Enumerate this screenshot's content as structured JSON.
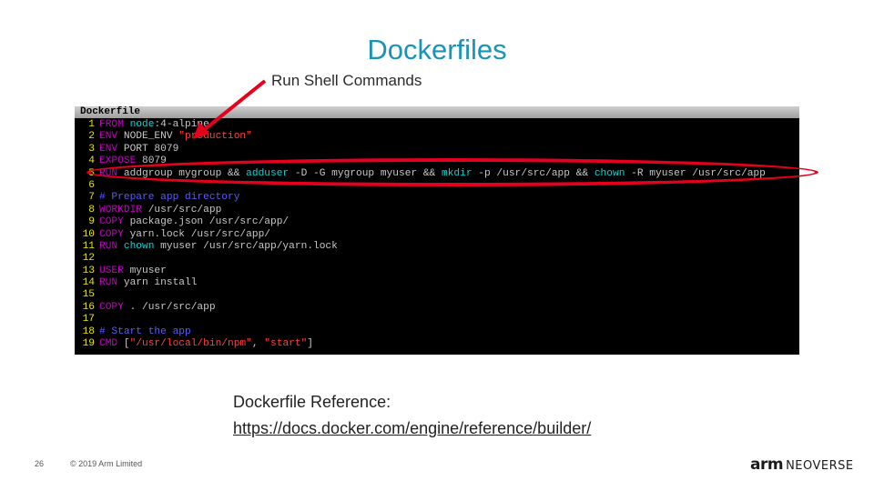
{
  "slide": {
    "title": "Dockerfiles",
    "callout": "Run Shell Commands",
    "reference_label": "Dockerfile Reference:",
    "reference_link": "https://docs.docker.com/engine/reference/builder/",
    "page_number": "26",
    "copyright": "© 2019 Arm Limited",
    "logo_primary": "arm",
    "logo_secondary": "NEOVERSE"
  },
  "editor": {
    "tab_label": "Dockerfile",
    "lines": [
      {
        "n": "1",
        "segments": [
          [
            "kw",
            "FROM "
          ],
          [
            "cmd",
            "node"
          ],
          [
            "plain",
            ":4-alpine"
          ]
        ]
      },
      {
        "n": "2",
        "segments": [
          [
            "kw",
            "ENV "
          ],
          [
            "plain",
            "NODE_ENV "
          ],
          [
            "str",
            "\"production\""
          ]
        ]
      },
      {
        "n": "3",
        "segments": [
          [
            "kw",
            "ENV "
          ],
          [
            "plain",
            "PORT 8079"
          ]
        ]
      },
      {
        "n": "4",
        "segments": [
          [
            "kw",
            "EXPOSE "
          ],
          [
            "plain",
            "8079"
          ]
        ]
      },
      {
        "n": "5",
        "segments": [
          [
            "kw",
            "RUN "
          ],
          [
            "plain",
            "addgroup mygroup && "
          ],
          [
            "cmd",
            "adduser"
          ],
          [
            "plain",
            " -D -G mygroup myuser && "
          ],
          [
            "cmd",
            "mkdir"
          ],
          [
            "plain",
            " -p /usr/src/app && "
          ],
          [
            "cmd",
            "chown"
          ],
          [
            "plain",
            " -R myuser /usr/src/app"
          ]
        ]
      },
      {
        "n": "6",
        "segments": []
      },
      {
        "n": "7",
        "segments": [
          [
            "cmt",
            "# Prepare app directory"
          ]
        ]
      },
      {
        "n": "8",
        "segments": [
          [
            "kw",
            "WORKDIR "
          ],
          [
            "plain",
            "/usr/src/app"
          ]
        ]
      },
      {
        "n": "9",
        "segments": [
          [
            "kw",
            "COPY "
          ],
          [
            "plain",
            "package.json /usr/src/app/"
          ]
        ]
      },
      {
        "n": "10",
        "segments": [
          [
            "kw",
            "COPY "
          ],
          [
            "plain",
            "yarn.lock /usr/src/app/"
          ]
        ]
      },
      {
        "n": "11",
        "segments": [
          [
            "kw",
            "RUN "
          ],
          [
            "cmd",
            "chown"
          ],
          [
            "plain",
            " myuser /usr/src/app/yarn.lock"
          ]
        ]
      },
      {
        "n": "12",
        "segments": []
      },
      {
        "n": "13",
        "segments": [
          [
            "kw",
            "USER "
          ],
          [
            "plain",
            "myuser"
          ]
        ]
      },
      {
        "n": "14",
        "segments": [
          [
            "kw",
            "RUN "
          ],
          [
            "plain",
            "yarn install"
          ]
        ]
      },
      {
        "n": "15",
        "segments": []
      },
      {
        "n": "16",
        "segments": [
          [
            "kw",
            "COPY "
          ],
          [
            "plain",
            ". /usr/src/app"
          ]
        ]
      },
      {
        "n": "17",
        "segments": []
      },
      {
        "n": "18",
        "segments": [
          [
            "cmt",
            "# Start the app"
          ]
        ]
      },
      {
        "n": "19",
        "segments": [
          [
            "kw",
            "CMD "
          ],
          [
            "plain",
            "["
          ],
          [
            "str",
            "\"/usr/local/bin/npm\""
          ],
          [
            "plain",
            ", "
          ],
          [
            "str",
            "\"start\""
          ],
          [
            "plain",
            "]"
          ]
        ]
      }
    ]
  },
  "colors": {
    "title": "#1794b8",
    "highlight": "#e5001d",
    "keyword": "#c800c8",
    "command": "#00d7d7",
    "string": "#ff4040",
    "comment": "#5a5aff",
    "line_number": "#e6e600"
  },
  "icons": {
    "arrow": "arrow-pointing-to-line-5",
    "highlight": "red-ellipse-around-line-5"
  }
}
